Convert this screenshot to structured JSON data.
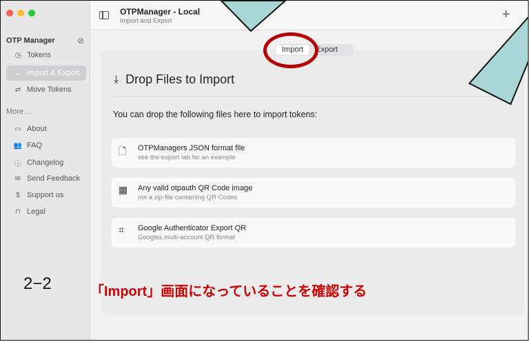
{
  "sidebar": {
    "title": "OTP Manager",
    "sync_icon": "cloud-slash-icon",
    "items": [
      {
        "label": "Tokens",
        "icon": "clock-icon"
      },
      {
        "label": "Import & Export",
        "icon": "arrows-icon"
      },
      {
        "label": "Move Tokens",
        "icon": "transfer-icon"
      }
    ],
    "more_label": "More ...",
    "more_items": [
      {
        "label": "About",
        "icon": "window-icon"
      },
      {
        "label": "FAQ",
        "icon": "people-icon"
      },
      {
        "label": "Changelog",
        "icon": "info-icon"
      },
      {
        "label": "Send Feedback",
        "icon": "mail-icon"
      },
      {
        "label": "Support us",
        "icon": "dollar-icon"
      },
      {
        "label": "Legal",
        "icon": "bookmark-icon"
      }
    ]
  },
  "window": {
    "title": "OTPManager - Local",
    "subtitle": "Import and Export",
    "plus_label": "+"
  },
  "tabs": [
    {
      "label": "Import",
      "selected": true
    },
    {
      "label": "Export",
      "selected": false
    }
  ],
  "main": {
    "drop_title": "Drop Files to Import",
    "description": "You can drop the following files here to import tokens:",
    "files": [
      {
        "title": "OTPManagers JSON format file",
        "subtitle": "see the export tab for an example",
        "icon": "document-icon"
      },
      {
        "title": "Any valid otpauth QR Code image",
        "subtitle": "not a zip-file containing QR Codes",
        "icon": "qr-code-icon"
      },
      {
        "title": "Google Authenticator Export QR",
        "subtitle": "Googles multi-account QR format",
        "icon": "qr-scan-icon"
      }
    ]
  },
  "annotation": {
    "step": "2−2",
    "text": "「Import」画面になっていることを確認する"
  },
  "colors": {
    "accent_red": "#cc0000",
    "callout": "#aad6d8",
    "sidebar_bg": "#e7e7e8"
  }
}
